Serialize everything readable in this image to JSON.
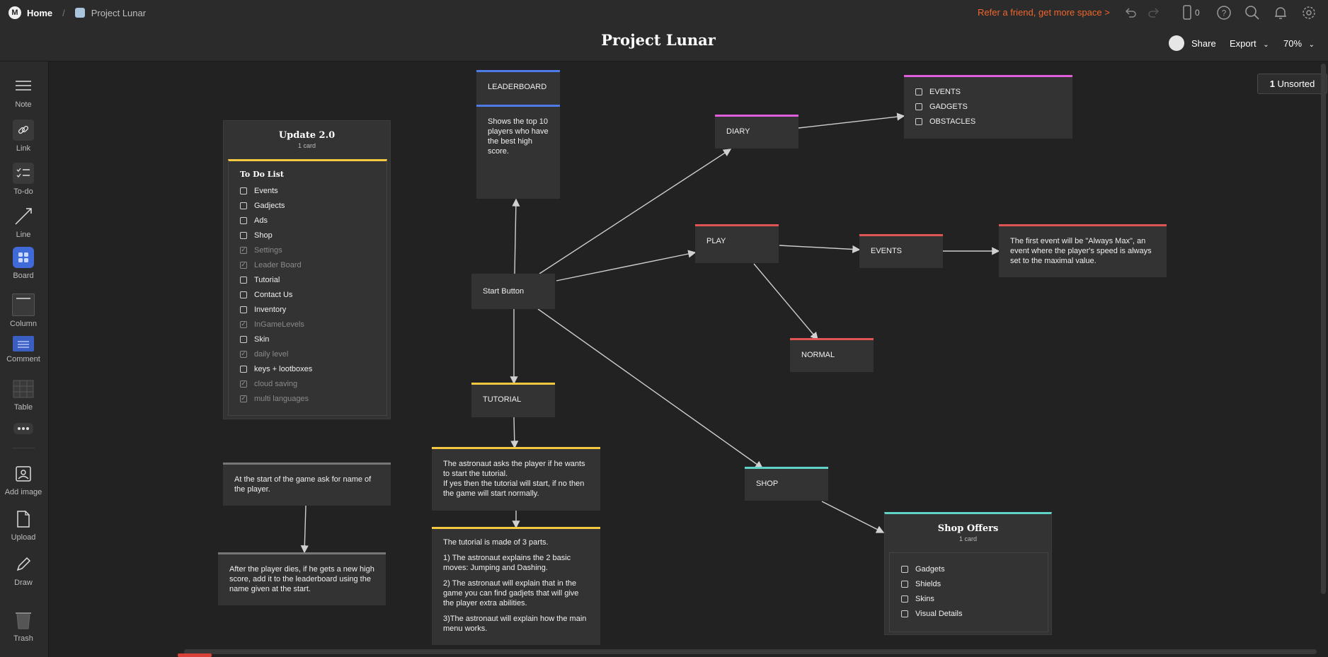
{
  "topbar": {
    "home_label": "Home",
    "board_name": "Project Lunar",
    "refer_text": "Refer a friend, get more space >",
    "device_count": "0",
    "colors": {
      "refer": "#f0662c",
      "bg": "#2b2b2b"
    }
  },
  "header": {
    "title": "Project Lunar",
    "share_label": "Share",
    "export_label": "Export",
    "zoom": "70%"
  },
  "sidebar": {
    "tools": [
      {
        "label": "Note",
        "icon": "note-icon"
      },
      {
        "label": "Link",
        "icon": "link-icon"
      },
      {
        "label": "To-do",
        "icon": "todo-icon"
      },
      {
        "label": "Line",
        "icon": "line-icon"
      },
      {
        "label": "Board",
        "icon": "board-icon"
      },
      {
        "label": "Column",
        "icon": "column-icon"
      },
      {
        "label": "Comment",
        "icon": "comment-icon"
      },
      {
        "label": "Table",
        "icon": "table-icon"
      },
      {
        "label": "",
        "icon": "more-icon"
      },
      {
        "label": "Add image",
        "icon": "add-image-icon"
      },
      {
        "label": "Upload",
        "icon": "upload-icon"
      },
      {
        "label": "Draw",
        "icon": "draw-icon"
      },
      {
        "label": "Trash",
        "icon": "trash-icon"
      }
    ]
  },
  "unsorted": {
    "count": "1",
    "label": "Unsorted"
  },
  "canvas": {
    "update_board": {
      "title": "Update 2.0",
      "subtitle": "1 card",
      "todo_title": "To Do List",
      "items": [
        {
          "label": "Events",
          "done": false
        },
        {
          "label": "Gadjects",
          "done": false
        },
        {
          "label": "Ads",
          "done": false
        },
        {
          "label": "Shop",
          "done": false
        },
        {
          "label": "Settings",
          "done": true
        },
        {
          "label": "Leader Board",
          "done": true
        },
        {
          "label": "Tutorial",
          "done": false
        },
        {
          "label": "Contact Us",
          "done": false
        },
        {
          "label": "Inventory",
          "done": false
        },
        {
          "label": "InGameLevels",
          "done": true
        },
        {
          "label": "Skin",
          "done": false
        },
        {
          "label": "daily level",
          "done": true
        },
        {
          "label": "keys + lootboxes",
          "done": false
        },
        {
          "label": "cloud saving",
          "done": true
        },
        {
          "label": "multi languages",
          "done": true
        }
      ]
    },
    "note_name": "At the start of the game ask for name of the player.",
    "note_after_death": "After the player dies, if he gets a new high score, add it to the leaderboard using the name given at the start.",
    "leaderboard": {
      "title": "LEADERBOARD",
      "desc": "Shows the top 10 players who have the best high score."
    },
    "start_button": "Start Button",
    "tutorial": {
      "title": "TUTORIAL",
      "desc_lines": [
        "The astronaut asks the player if he wants to start the tutorial.",
        "If yes then the tutorial will start, if no then the game will start normally."
      ],
      "parts": [
        "The tutorial is made of 3 parts.",
        "1) The astronaut explains the 2 basic moves: Jumping and Dashing.",
        "2) The astronaut will explain that in the game you can find gadjets that will give the player extra abilities.",
        "3)The astronaut will explain how the main menu works."
      ]
    },
    "diary": {
      "title": "DIARY",
      "items": [
        "EVENTS",
        "GADGETS",
        "OBSTACLES"
      ]
    },
    "play": {
      "title": "PLAY",
      "events_title": "EVENTS",
      "normal_title": "NORMAL",
      "event_desc": "The first event will be \"Always Max\", an event where the player's speed is always set to the maximal value."
    },
    "shop": {
      "title": "SHOP",
      "offers_title": "Shop Offers",
      "offers_sub": "1 card",
      "items": [
        "Gadgets",
        "Shields",
        "Skins",
        "Visual Details"
      ]
    }
  }
}
